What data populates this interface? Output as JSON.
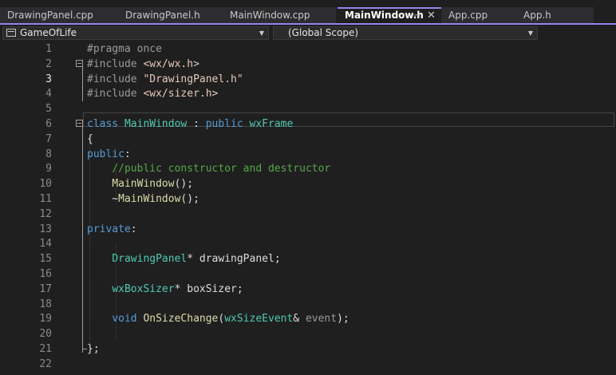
{
  "tabs": [
    {
      "label": "DrawingPanel.cpp",
      "active": false
    },
    {
      "label": "DrawingPanel.h",
      "active": false
    },
    {
      "label": "MainWindow.cpp",
      "active": false
    },
    {
      "label": "MainWindow.h",
      "active": true
    },
    {
      "label": "App.cpp",
      "active": false
    },
    {
      "label": "App.h",
      "active": false
    }
  ],
  "navbar": {
    "project": "GameOfLife",
    "scope": "(Global Scope)"
  },
  "editor": {
    "current_line": 3,
    "line_numbers": [
      "1",
      "2",
      "3",
      "4",
      "5",
      "6",
      "7",
      "8",
      "9",
      "10",
      "11",
      "12",
      "13",
      "14",
      "15",
      "16",
      "17",
      "18",
      "19",
      "20",
      "21",
      "22"
    ],
    "lines": [
      [
        {
          "t": "#pragma once",
          "c": "pre"
        }
      ],
      [
        {
          "t": "#include ",
          "c": "pre"
        },
        {
          "t": "<wx/wx.h>",
          "c": "str"
        }
      ],
      [
        {
          "t": "#include ",
          "c": "pre"
        },
        {
          "t": "\"DrawingPanel.h\"",
          "c": "str"
        }
      ],
      [
        {
          "t": "#include ",
          "c": "pre"
        },
        {
          "t": "<wx/sizer.h>",
          "c": "str"
        }
      ],
      [],
      [
        {
          "t": "class ",
          "c": "kw"
        },
        {
          "t": "MainWindow",
          "c": "type"
        },
        {
          "t": " : ",
          "c": "id"
        },
        {
          "t": "public ",
          "c": "kw"
        },
        {
          "t": "wxFrame",
          "c": "type"
        }
      ],
      [
        {
          "t": "{",
          "c": "id"
        }
      ],
      [
        {
          "t": "public",
          "c": "kw"
        },
        {
          "t": ":",
          "c": "id"
        }
      ],
      [
        {
          "t": "    ",
          "c": "id"
        },
        {
          "t": "//public constructor and destructor",
          "c": "cm"
        }
      ],
      [
        {
          "t": "    ",
          "c": "id"
        },
        {
          "t": "MainWindow",
          "c": "fn"
        },
        {
          "t": "();",
          "c": "id"
        }
      ],
      [
        {
          "t": "    ~",
          "c": "id"
        },
        {
          "t": "MainWindow",
          "c": "fn"
        },
        {
          "t": "();",
          "c": "id"
        }
      ],
      [],
      [
        {
          "t": "private",
          "c": "kw"
        },
        {
          "t": ":",
          "c": "id"
        }
      ],
      [],
      [
        {
          "t": "    ",
          "c": "id"
        },
        {
          "t": "DrawingPanel",
          "c": "type"
        },
        {
          "t": "* ",
          "c": "id"
        },
        {
          "t": "drawingPanel",
          "c": "id"
        },
        {
          "t": ";",
          "c": "id"
        }
      ],
      [],
      [
        {
          "t": "    ",
          "c": "id"
        },
        {
          "t": "wxBoxSizer",
          "c": "type"
        },
        {
          "t": "* ",
          "c": "id"
        },
        {
          "t": "boxSizer",
          "c": "id"
        },
        {
          "t": ";",
          "c": "id"
        }
      ],
      [],
      [
        {
          "t": "    ",
          "c": "id"
        },
        {
          "t": "void ",
          "c": "kw"
        },
        {
          "t": "OnSizeChange",
          "c": "fn"
        },
        {
          "t": "(",
          "c": "id"
        },
        {
          "t": "wxSizeEvent",
          "c": "type"
        },
        {
          "t": "& ",
          "c": "id"
        },
        {
          "t": "event",
          "c": "pm"
        },
        {
          "t": ");",
          "c": "id"
        }
      ],
      [],
      [
        {
          "t": "};",
          "c": "id"
        }
      ],
      []
    ]
  }
}
